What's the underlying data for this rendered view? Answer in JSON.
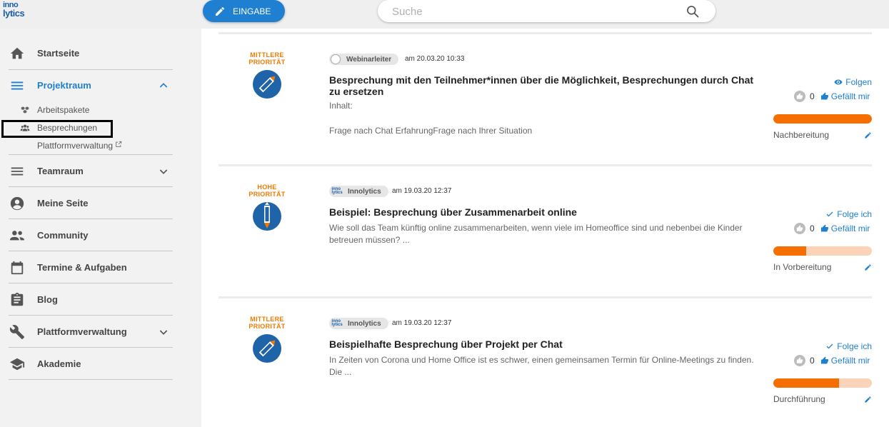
{
  "header": {
    "logo_line1": "inno",
    "logo_line2": "lytics",
    "eingabe_label": "EINGABE",
    "search_placeholder": "Suche"
  },
  "sidebar": {
    "startseite": "Startseite",
    "projektraum": "Projektraum",
    "sub_items": [
      "Arbeitspakete",
      "Besprechungen",
      "Plattformverwaltung"
    ],
    "teamraum": "Teamraum",
    "meine_seite": "Meine Seite",
    "community": "Community",
    "termine": "Termine & Aufgaben",
    "blog": "Blog",
    "plattformverwaltung": "Plattformverwaltung",
    "akademie": "Akademie"
  },
  "colors": {
    "accent": "#1f7fd1",
    "priority_orange": "#f07a00",
    "progress_fill": "#f56e00",
    "progress_track": "#fbd3b8"
  },
  "cards": [
    {
      "priority_line1": "MITTLERE",
      "priority_line2": "PRIORITÄT",
      "author": "Webinarleiter",
      "date": "am 20.03.20 10:33",
      "title": "Besprechung mit den Teilnehmer*innen über die Möglichkeit, Besprechungen durch Chat zu ersetzen",
      "desc1": "Inhalt:",
      "desc2": "Frage nach Chat ErfahrungFrage nach Ihrer Situation",
      "follow": "Folgen",
      "likes": "0",
      "like_label": "Gefällt mir",
      "progress": 1.0,
      "status": "Nachbereitung"
    },
    {
      "priority_line1": "HOHE",
      "priority_line2": "PRIORITÄT",
      "author": "Innolytics",
      "date": "am 19.03.20 12:37",
      "title": "Beispiel: Besprechung über Zusammenarbeit online",
      "desc1": "Wie soll das Team künftig online zusammenarbeiten, wenn viele im Homeoffice sind und nebenbei die Kinder betreuen müssen? ...",
      "follow": "Folge ich",
      "likes": "0",
      "like_label": "Gefällt mir",
      "progress": 0.33,
      "status": "In Vorbereitung"
    },
    {
      "priority_line1": "MITTLERE",
      "priority_line2": "PRIORITÄT",
      "author": "Innolytics",
      "date": "am 19.03.20 12:37",
      "title": "Beispielhafte Besprechung über Projekt per Chat",
      "desc1": "In Zeiten von Corona und Home Office ist es schwer, einen gemeinsamen Termin für Online-Meetings zu finden. Die ...",
      "follow": "Folge ich",
      "likes": "0",
      "like_label": "Gefällt mir",
      "progress": 0.67,
      "status": "Durchführung"
    }
  ]
}
